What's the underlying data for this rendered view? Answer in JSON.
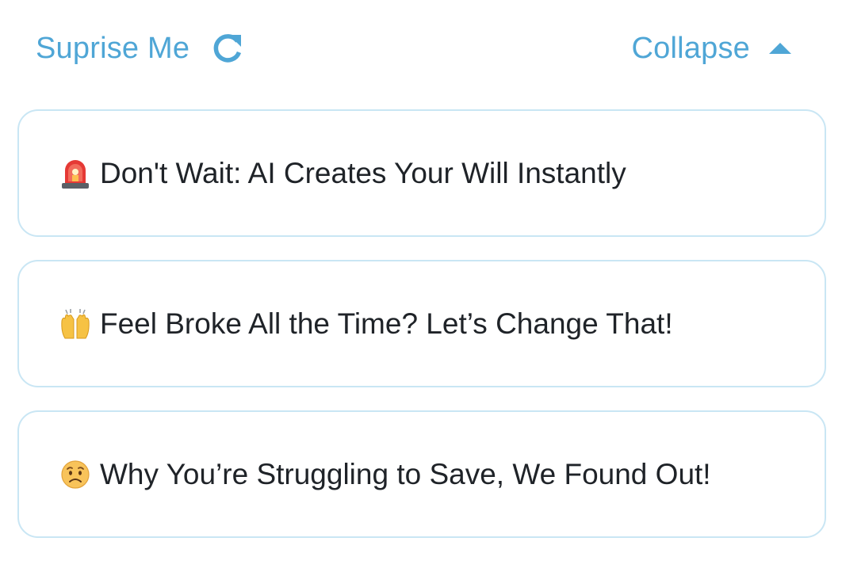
{
  "toolbar": {
    "surprise_label": "Suprise Me",
    "surprise_icon": "refresh-icon",
    "collapse_label": "Collapse",
    "collapse_icon": "caret-up-icon"
  },
  "suggestions": [
    {
      "icon": "siren-icon",
      "text": "Don't Wait: AI Creates Your Will Instantly"
    },
    {
      "icon": "raising-hands-icon",
      "text": "Feel Broke All the Time? Let’s Change That!"
    },
    {
      "icon": "worried-face-icon",
      "text": "Why You’re Struggling to Save, We Found Out!"
    }
  ],
  "colors": {
    "accent": "#4fa6d6",
    "card_border": "#c9e6f4",
    "text": "#1f2328",
    "background": "#ffffff"
  }
}
